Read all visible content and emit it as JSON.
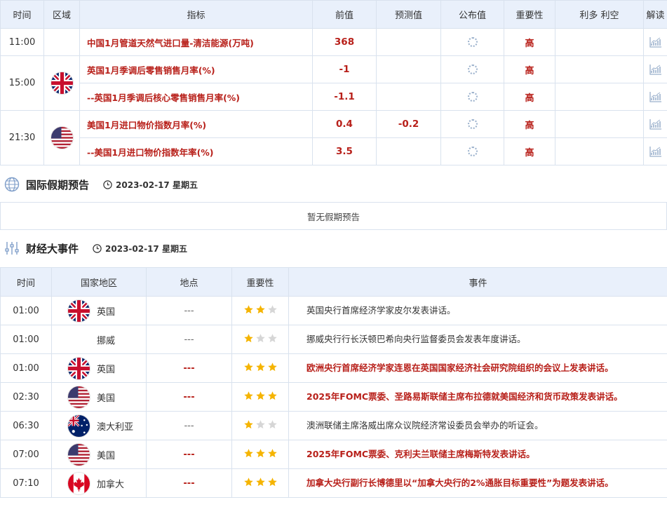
{
  "colors": {
    "accent_red": "#b8201a",
    "header_bg": "#e9f0fb",
    "border": "#d9e2ee",
    "star_on": "#f5b400",
    "star_off": "#d6d6d6"
  },
  "indicators": {
    "headers": [
      "时间",
      "区域",
      "指标",
      "前值",
      "预测值",
      "公布值",
      "重要性",
      "利多 利空",
      "解读"
    ],
    "groups": [
      {
        "time": "11:00",
        "flag": "",
        "rows": [
          {
            "name": "中国1月管道天然气进口量-清洁能源(万吨)",
            "prev": "368",
            "forecast": "",
            "importance": "高"
          }
        ]
      },
      {
        "time": "15:00",
        "flag": "uk",
        "rows": [
          {
            "name": "英国1月季调后零售销售月率(%)",
            "prev": "-1",
            "forecast": "",
            "importance": "高"
          },
          {
            "name": "--英国1月季调后核心零售销售月率(%)",
            "prev": "-1.1",
            "forecast": "",
            "importance": "高"
          }
        ]
      },
      {
        "time": "21:30",
        "flag": "us",
        "rows": [
          {
            "name": "美国1月进口物价指数月率(%)",
            "prev": "0.4",
            "forecast": "-0.2",
            "importance": "高"
          },
          {
            "name": "--美国1月进口物价指数年率(%)",
            "prev": "3.5",
            "forecast": "",
            "importance": "高"
          }
        ]
      }
    ]
  },
  "holiday": {
    "title": "国际假期预告",
    "date": "2023-02-17 星期五",
    "empty_text": "暂无假期预告",
    "icon": "globe-icon"
  },
  "events": {
    "title": "财经大事件",
    "date": "2023-02-17 星期五",
    "icon": "sliders-icon",
    "headers": [
      "时间",
      "国家地区",
      "地点",
      "重要性",
      "事件"
    ],
    "rows": [
      {
        "time": "01:00",
        "flag": "uk",
        "country": "英国",
        "place": "---",
        "stars": 2,
        "event": "英国央行首席经济学家皮尔发表讲话。",
        "high": false
      },
      {
        "time": "01:00",
        "flag": "",
        "country": "挪威",
        "place": "---",
        "stars": 1,
        "event": "挪威央行行长沃顿巴希向央行监督委员会发表年度讲话。",
        "high": false
      },
      {
        "time": "01:00",
        "flag": "uk",
        "country": "英国",
        "place": "---",
        "stars": 3,
        "event": "欧洲央行首席经济学家连恩在英国国家经济社会研究院组织的会议上发表讲话。",
        "high": true
      },
      {
        "time": "02:30",
        "flag": "us",
        "country": "美国",
        "place": "---",
        "stars": 3,
        "event": "2025年FOMC票委、圣路易斯联储主席布拉德就美国经济和货币政策发表讲话。",
        "high": true
      },
      {
        "time": "06:30",
        "flag": "au",
        "country": "澳大利亚",
        "place": "---",
        "stars": 1,
        "event": "澳洲联储主席洛威出席众议院经济常设委员会举办的听证会。",
        "high": false
      },
      {
        "time": "07:00",
        "flag": "us",
        "country": "美国",
        "place": "---",
        "stars": 3,
        "event": "2025年FOMC票委、克利夫兰联储主席梅斯特发表讲话。",
        "high": true
      },
      {
        "time": "07:10",
        "flag": "ca",
        "country": "加拿大",
        "place": "---",
        "stars": 3,
        "event": "加拿大央行副行长博德里以“加拿大央行的2%通胀目标重要性”为题发表讲话。",
        "high": true
      }
    ]
  }
}
